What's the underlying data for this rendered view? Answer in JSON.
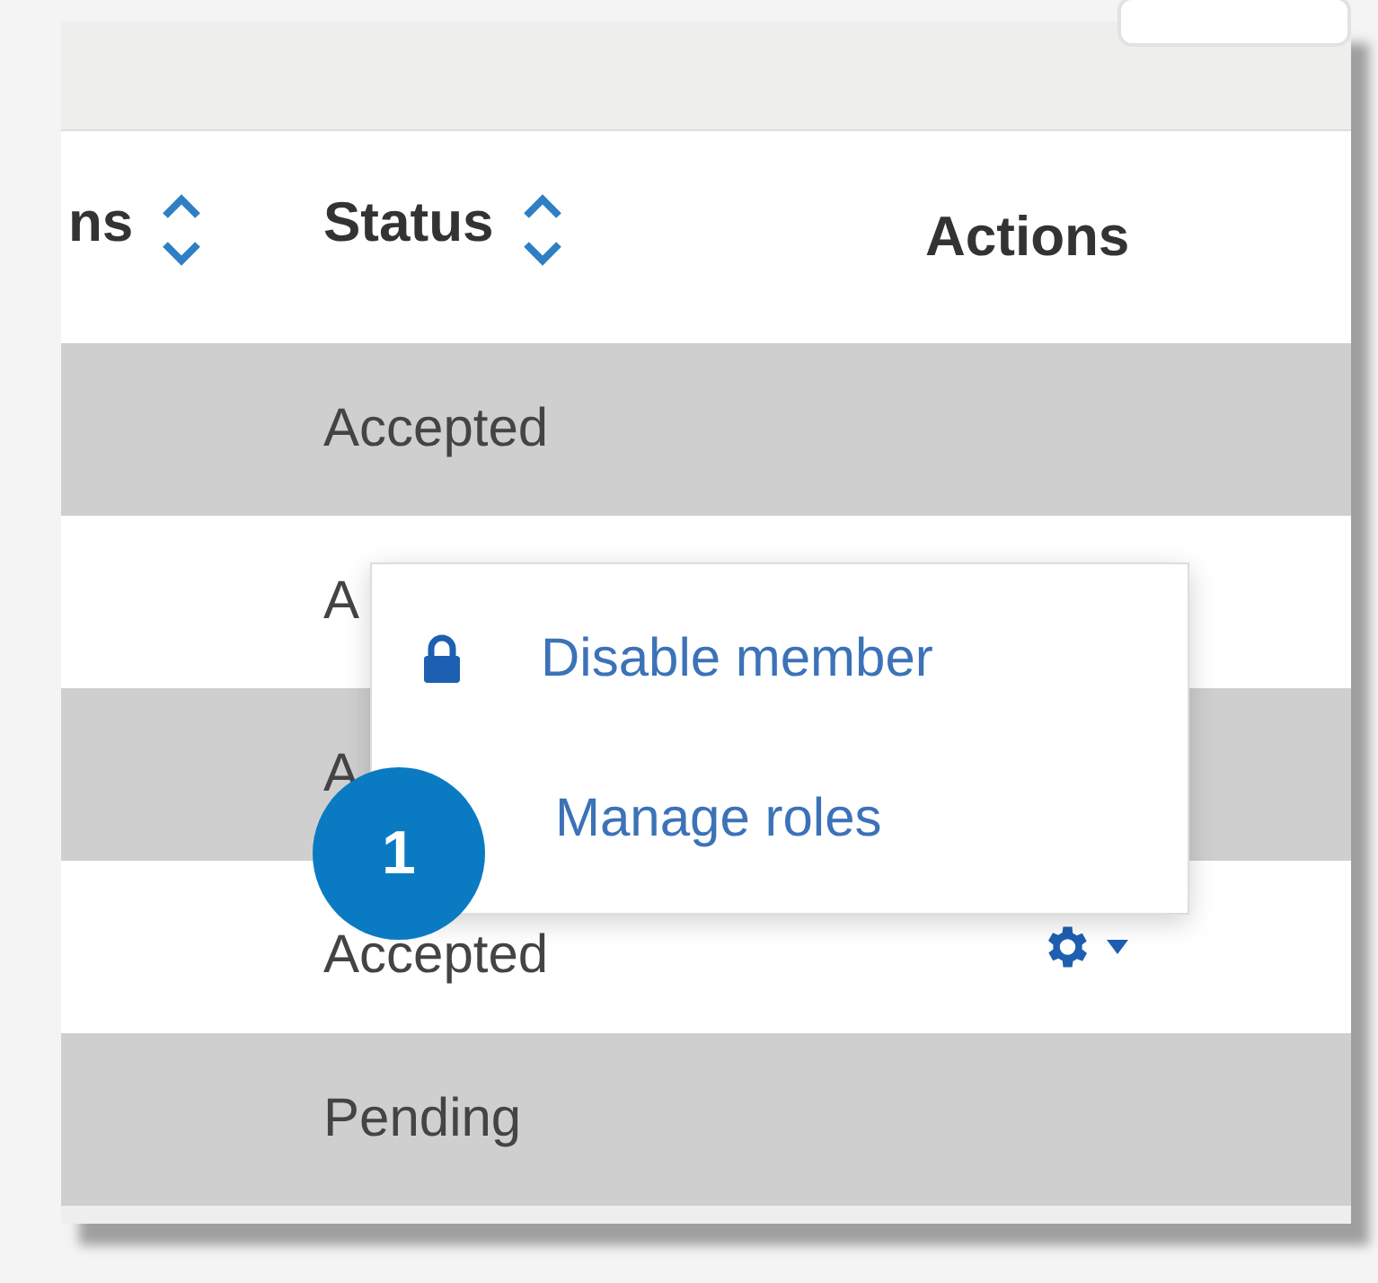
{
  "table": {
    "columns": [
      {
        "label": "ns",
        "sortable": true
      },
      {
        "label": "Status",
        "sortable": true
      },
      {
        "label": "Actions",
        "sortable": false
      }
    ],
    "rows": [
      {
        "status": "Accepted",
        "shaded": true
      },
      {
        "status": "A",
        "shaded": false
      },
      {
        "status": "A",
        "shaded": true
      },
      {
        "status": "Accepted",
        "shaded": false,
        "has_menu": true
      },
      {
        "status": "Pending",
        "shaded": true
      }
    ]
  },
  "menu": {
    "items": [
      {
        "label": "Disable member",
        "kind": "locked"
      },
      {
        "label": "Manage roles",
        "kind": "plain"
      }
    ]
  },
  "callout": {
    "number": "1"
  }
}
